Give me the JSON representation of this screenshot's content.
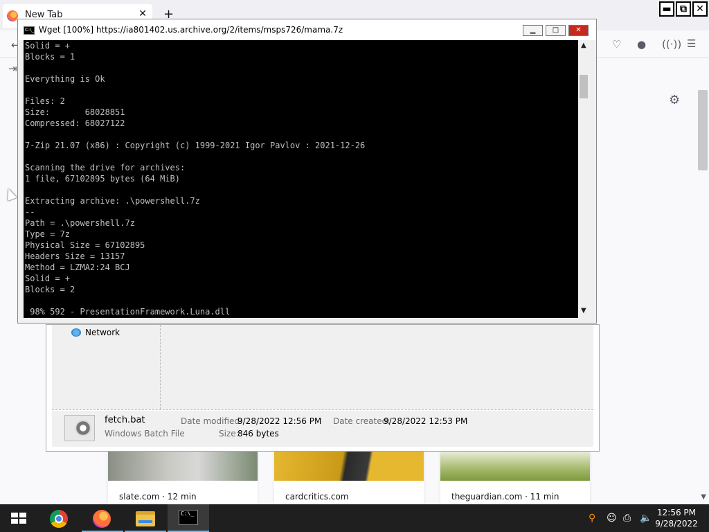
{
  "firefox": {
    "tab_title": "New Tab",
    "tab_close": "✕",
    "new_tab": "+",
    "window_buttons": {
      "minimize": "▬",
      "restore": "⧉",
      "close": "✕"
    },
    "settings_icon": "⚙",
    "tiles": [
      {
        "label": "slate.com · 12 min"
      },
      {
        "label": "cardcritics.com"
      },
      {
        "label": "theguardian.com · 11 min"
      }
    ]
  },
  "explorer": {
    "nav_item": "Network",
    "file": {
      "name": "fetch.bat",
      "type": "Windows Batch File",
      "date_modified_label": "Date modified:",
      "date_modified": "9/28/2022 12:56 PM",
      "date_created_label": "Date created:",
      "date_created": "9/28/2022 12:53 PM",
      "size_label": "Size:",
      "size": "846 bytes"
    }
  },
  "console": {
    "title": "Wget [100%] https://ia801402.us.archive.org/2/items/msps726/mama.7z",
    "icon_text": "C:\\_",
    "buttons": {
      "minimize": "▁",
      "maximize": "□",
      "close": "✕"
    },
    "lines": [
      "Solid = +",
      "Blocks = 1",
      "",
      "Everything is Ok",
      "",
      "Files: 2",
      "Size:       68028851",
      "Compressed: 68027122",
      "",
      "7-Zip 21.07 (x86) : Copyright (c) 1999-2021 Igor Pavlov : 2021-12-26",
      "",
      "Scanning the drive for archives:",
      "1 file, 67102895 bytes (64 MiB)",
      "",
      "Extracting archive: .\\powershell.7z",
      "--",
      "Path = .\\powershell.7z",
      "Type = 7z",
      "Physical Size = 67102895",
      "Headers Size = 13157",
      "Method = LZMA2:24 BCJ",
      "Solid = +",
      "Blocks = 2",
      "",
      " 98% 592 - PresentationFramework.Luna.dll"
    ]
  },
  "taskbar": {
    "cmd_icon_text": "C:\\_",
    "time": "12:56 PM",
    "date": "9/28/2022"
  }
}
